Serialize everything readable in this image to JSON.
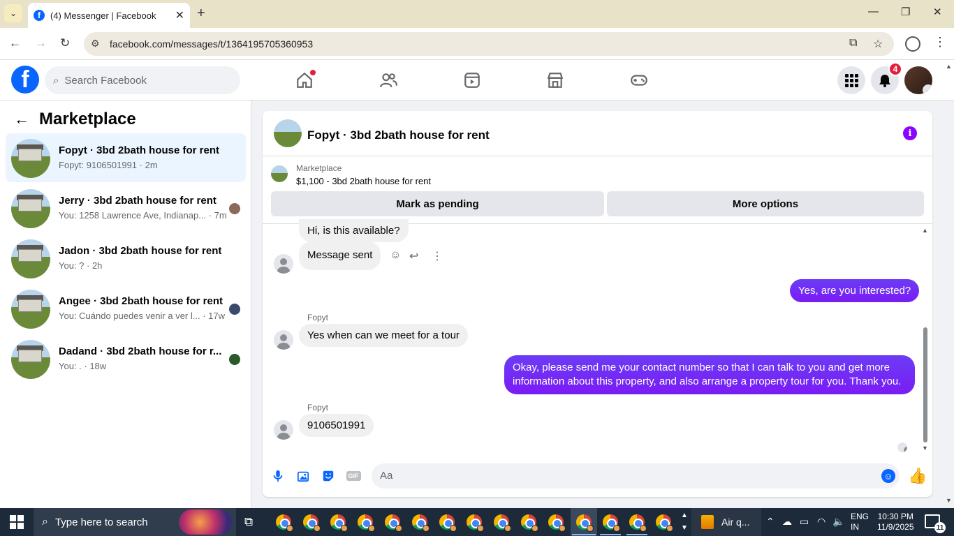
{
  "browser": {
    "tab_title": "(4) Messenger | Facebook",
    "url": "facebook.com/messages/t/1364195705360953"
  },
  "fb": {
    "search_placeholder": "Search Facebook",
    "notification_count": "4"
  },
  "sidebar": {
    "title": "Marketplace",
    "conversations": [
      {
        "name": "Fopyt · 3bd 2bath house for rent",
        "snippet": "Fopyt: 9106501991 · 2m",
        "active": true
      },
      {
        "name": "Jerry · 3bd 2bath house for rent",
        "snippet": "You: 1258 Lawrence Ave, Indianap... · 7m",
        "active": false
      },
      {
        "name": "Jadon · 3bd 2bath house for rent",
        "snippet": "You: ? · 2h",
        "active": false
      },
      {
        "name": "Angee · 3bd 2bath house for rent",
        "snippet": "You: Cuándo puedes venir a ver l... · 17w",
        "active": false
      },
      {
        "name": "Dadand · 3bd 2bath house for r...",
        "snippet": "You: . · 18w",
        "active": false
      }
    ]
  },
  "chat": {
    "title": "Fopyt · 3bd 2bath house for rent",
    "listing_source": "Marketplace",
    "listing_desc": "$1,100 - 3bd 2bath house for rent",
    "btn_pending": "Mark as pending",
    "btn_more": "More options",
    "messages": [
      {
        "from": "in",
        "text": "Hi, is this available?"
      },
      {
        "from": "in",
        "text": "Message sent"
      },
      {
        "from": "out",
        "text": "Yes, are you interested?"
      },
      {
        "from": "in",
        "sender": "Fopyt",
        "text": "Yes when can we meet for a tour"
      },
      {
        "from": "out",
        "text": "Okay, please send me your contact number so that I can talk to you and get more information about this property, and also arrange a property tour for you. Thank you."
      },
      {
        "from": "in",
        "sender": "Fopyt",
        "text": "9106501991"
      }
    ],
    "composer_placeholder": "Aa",
    "gif_label": "GIF"
  },
  "taskbar": {
    "search_placeholder": "Type here to search",
    "weather": "Air q...",
    "lang_1": "ENG",
    "lang_2": "IN",
    "time": "10:30 PM",
    "date": "11/9/2025",
    "notif_count": "11"
  }
}
